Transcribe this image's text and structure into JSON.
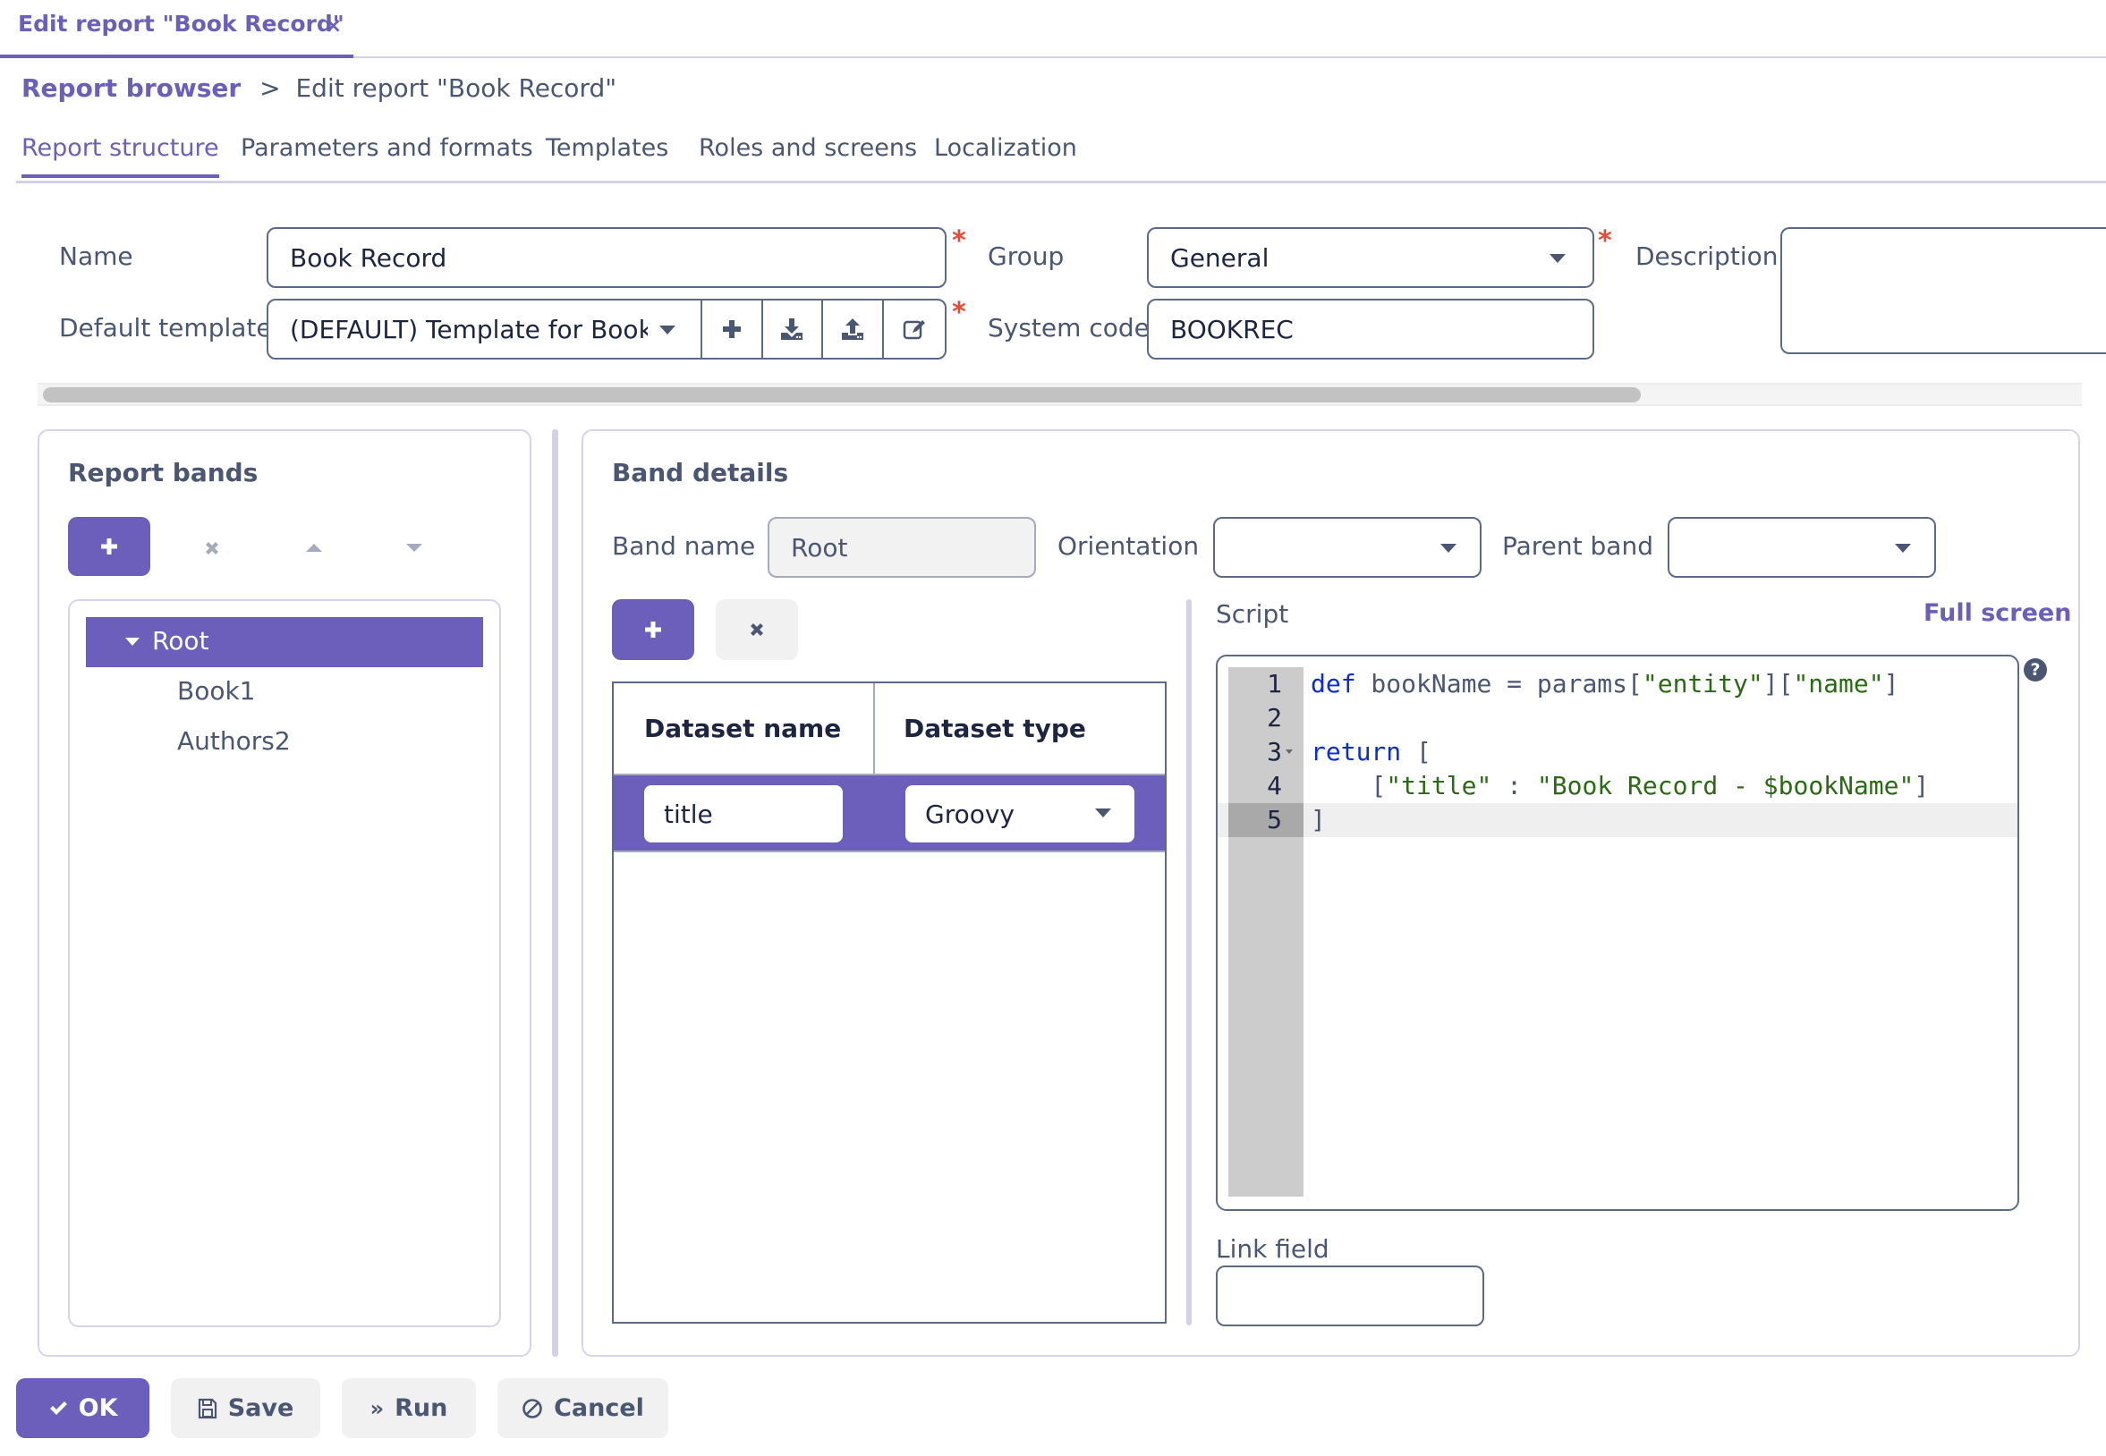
{
  "window_tab": {
    "title": "Edit report \"Book Record\"",
    "close_icon": "close-icon"
  },
  "breadcrumb": {
    "parent": "Report browser",
    "separator": ">",
    "current": "Edit report \"Book Record\""
  },
  "tabs": [
    {
      "label": "Report structure",
      "active": true
    },
    {
      "label": "Parameters and formats",
      "active": false
    },
    {
      "label": "Templates",
      "active": false
    },
    {
      "label": "Roles and screens",
      "active": false
    },
    {
      "label": "Localization",
      "active": false
    }
  ],
  "form": {
    "name": {
      "label": "Name",
      "value": "Book Record",
      "required": "*"
    },
    "default_template": {
      "label": "Default template",
      "value": "(DEFAULT) Template for BookR",
      "required": "*",
      "actions": [
        "plus-icon",
        "download-icon",
        "upload-icon",
        "edit-icon"
      ]
    },
    "group": {
      "label": "Group",
      "value": "General",
      "required": "*"
    },
    "system_code": {
      "label": "System code",
      "value": "BOOKREC"
    },
    "description": {
      "label": "Description",
      "value": ""
    }
  },
  "report_bands": {
    "title": "Report bands",
    "toolbar": [
      "plus-icon",
      "remove-icon",
      "move-up-icon",
      "move-down-icon"
    ],
    "tree": [
      {
        "label": "Root",
        "expanded": true,
        "selected": true,
        "level": 0
      },
      {
        "label": "Book1",
        "level": 1
      },
      {
        "label": "Authors2",
        "level": 1
      }
    ]
  },
  "band_details": {
    "title": "Band details",
    "band_name": {
      "label": "Band name",
      "value": "Root"
    },
    "orientation": {
      "label": "Orientation",
      "value": ""
    },
    "parent_band": {
      "label": "Parent band",
      "value": ""
    },
    "datasets": {
      "columns": [
        "Dataset name",
        "Dataset type"
      ],
      "rows": [
        {
          "name": "title",
          "type": "Groovy"
        }
      ]
    },
    "script": {
      "label": "Script",
      "full_screen": "Full screen",
      "help_icon": "question-circle-icon",
      "line_numbers": [
        "1",
        "2",
        "3",
        "4",
        "5"
      ],
      "lines": [
        [
          {
            "t": "kw",
            "v": "def"
          },
          {
            "t": "pl",
            "v": " bookName = params["
          },
          {
            "t": "str",
            "v": "\"entity\""
          },
          {
            "t": "pl",
            "v": "]["
          },
          {
            "t": "str",
            "v": "\"name\""
          },
          {
            "t": "pl",
            "v": "]"
          }
        ],
        [],
        [
          {
            "t": "kw",
            "v": "return"
          },
          {
            "t": "pl",
            "v": " ["
          }
        ],
        [
          {
            "t": "pl",
            "v": "    ["
          },
          {
            "t": "str",
            "v": "\"title\""
          },
          {
            "t": "pl",
            "v": " : "
          },
          {
            "t": "str",
            "v": "\"Book Record - $bookName\""
          },
          {
            "t": "pl",
            "v": "]"
          }
        ],
        [
          {
            "t": "pl",
            "v": "]"
          }
        ]
      ],
      "active_line": 5
    },
    "link_field": {
      "label": "Link field",
      "value": ""
    }
  },
  "footer": {
    "ok": "OK",
    "save": "Save",
    "run": "Run",
    "cancel": "Cancel"
  },
  "colors": {
    "accent": "#6b5fbb",
    "text": "#4a5672",
    "required": "#e04e39",
    "keyword": "#0b2bd8",
    "string": "#2a6a14"
  }
}
